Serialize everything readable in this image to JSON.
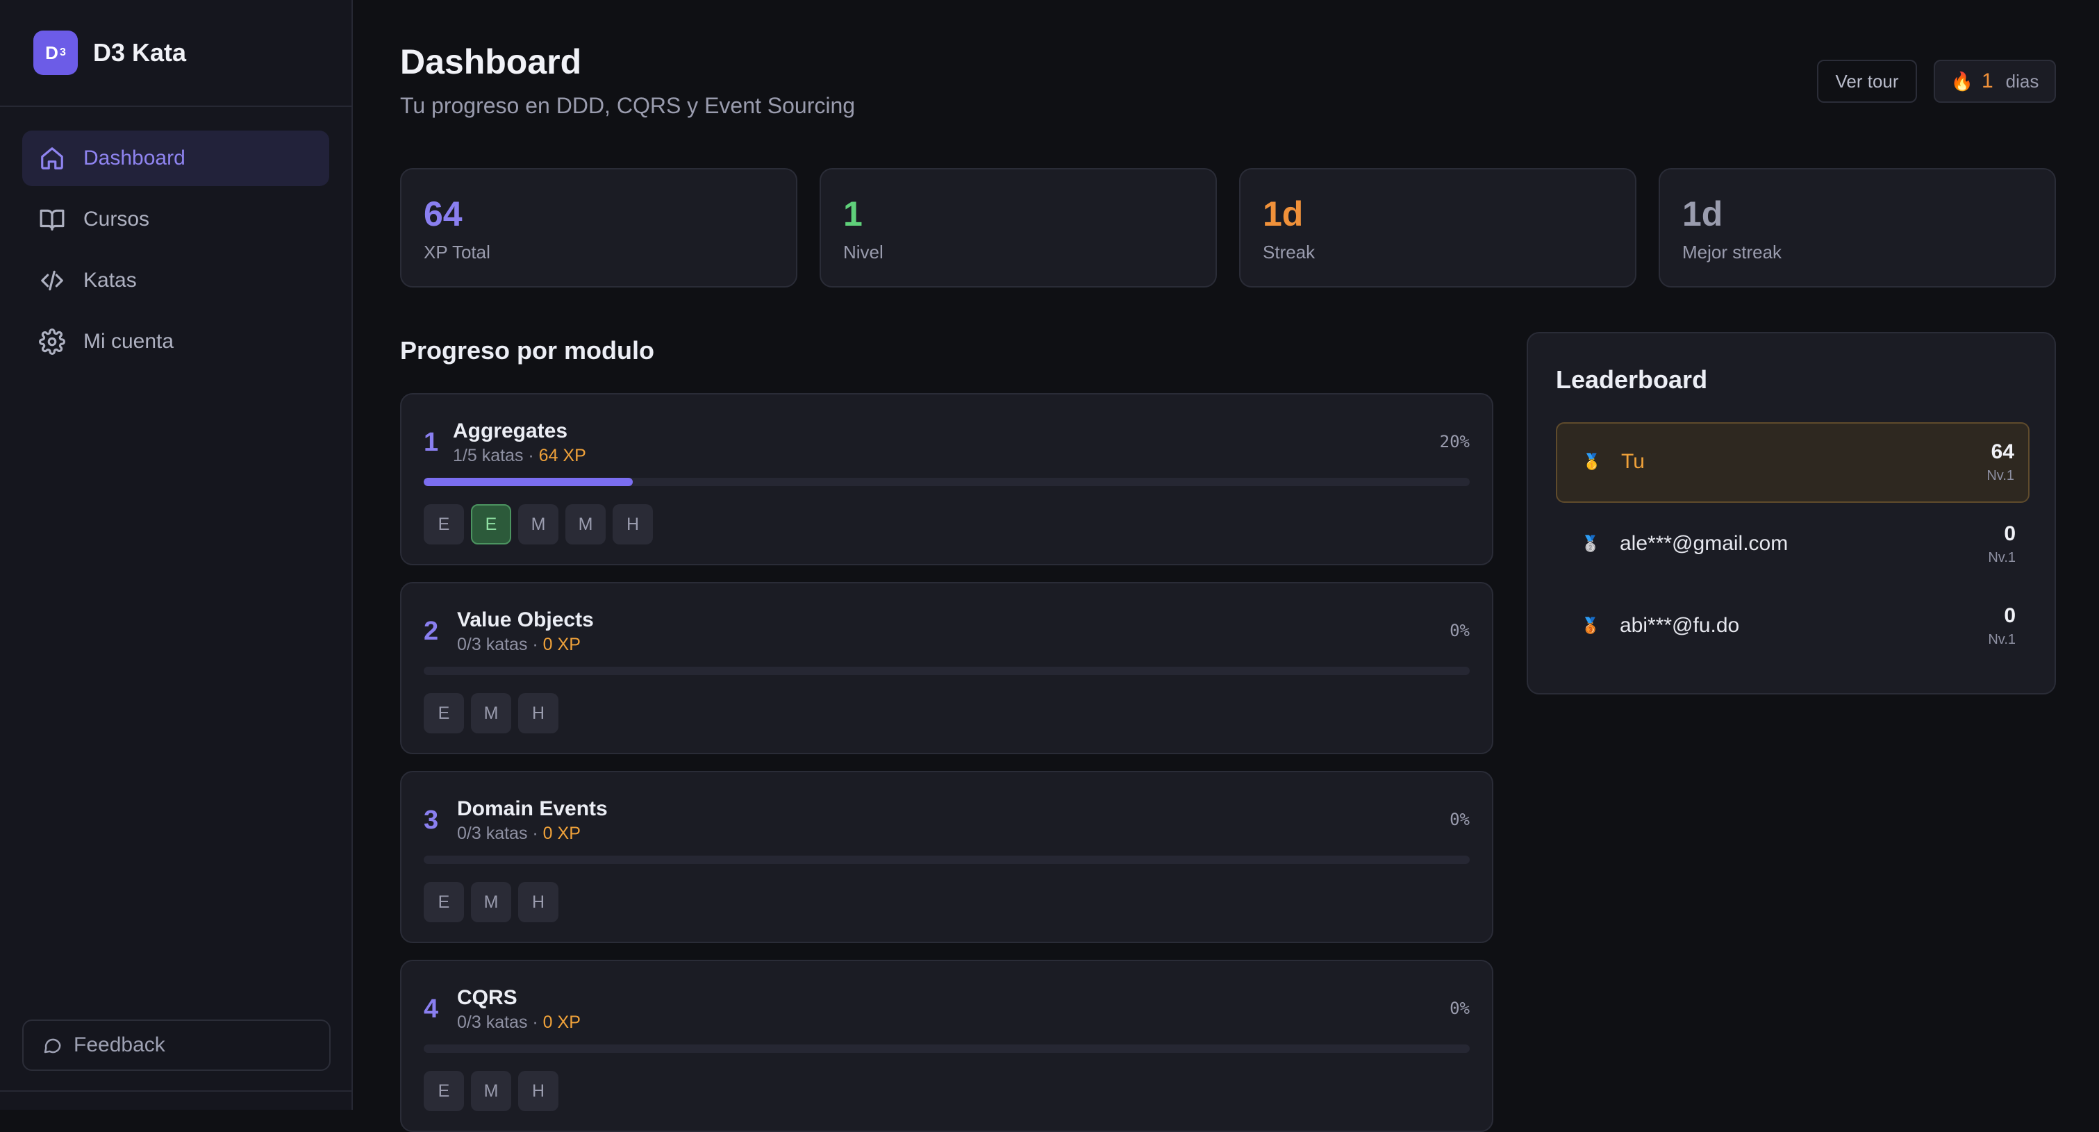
{
  "brand": {
    "logo_text": "D",
    "logo_sup": "3",
    "name": "D3 Kata"
  },
  "nav": {
    "items": [
      {
        "label": "Dashboard",
        "icon": "home-icon",
        "active": true
      },
      {
        "label": "Cursos",
        "icon": "book-icon",
        "active": false
      },
      {
        "label": "Katas",
        "icon": "code-icon",
        "active": false
      },
      {
        "label": "Mi cuenta",
        "icon": "gear-icon",
        "active": false
      }
    ]
  },
  "feedback": {
    "label": "Feedback",
    "icon": "chat-bubble-icon"
  },
  "header": {
    "title": "Dashboard",
    "subtitle": "Tu progreso en DDD, CQRS y Event Sourcing",
    "tour_label": "Ver tour",
    "streak_icon": "🔥",
    "streak_value": "1",
    "streak_unit": "dias"
  },
  "stats": [
    {
      "value": "64",
      "label": "XP Total",
      "color": "#8a7ff0"
    },
    {
      "value": "1",
      "label": "Nivel",
      "color": "#5fd07a"
    },
    {
      "value": "1d",
      "label": "Streak",
      "color": "#f0913a"
    },
    {
      "value": "1d",
      "label": "Mejor streak",
      "color": "#9a9cae"
    }
  ],
  "progress_section": {
    "title": "Progreso por modulo",
    "modules": [
      {
        "number": "1",
        "name": "Aggregates",
        "katas": "1/5 katas",
        "sep": " · ",
        "xp": "64 XP",
        "percent": "20%",
        "progress": 0.2,
        "chips": [
          {
            "label": "E",
            "done": false
          },
          {
            "label": "E",
            "done": true
          },
          {
            "label": "M",
            "done": false
          },
          {
            "label": "M",
            "done": false
          },
          {
            "label": "H",
            "done": false
          }
        ]
      },
      {
        "number": "2",
        "name": "Value Objects",
        "katas": "0/3 katas",
        "sep": " · ",
        "xp": "0 XP",
        "percent": "0%",
        "progress": 0,
        "chips": [
          {
            "label": "E",
            "done": false
          },
          {
            "label": "M",
            "done": false
          },
          {
            "label": "H",
            "done": false
          }
        ]
      },
      {
        "number": "3",
        "name": "Domain Events",
        "katas": "0/3 katas",
        "sep": " · ",
        "xp": "0 XP",
        "percent": "0%",
        "progress": 0,
        "chips": [
          {
            "label": "E",
            "done": false
          },
          {
            "label": "M",
            "done": false
          },
          {
            "label": "H",
            "done": false
          }
        ]
      },
      {
        "number": "4",
        "name": "CQRS",
        "katas": "0/3 katas",
        "sep": " · ",
        "xp": "0 XP",
        "percent": "0%",
        "progress": 0,
        "chips": [
          {
            "label": "E",
            "done": false
          },
          {
            "label": "M",
            "done": false
          },
          {
            "label": "H",
            "done": false
          }
        ]
      }
    ]
  },
  "leaderboard": {
    "title": "Leaderboard",
    "rows": [
      {
        "medal": "🥇",
        "name": "Tu",
        "score": "64",
        "level": "Nv.1",
        "is_me": true
      },
      {
        "medal": "🥈",
        "name": "ale***@gmail.com",
        "score": "0",
        "level": "Nv.1",
        "is_me": false
      },
      {
        "medal": "🥉",
        "name": "abi***@fu.do",
        "score": "0",
        "level": "Nv.1",
        "is_me": false
      }
    ]
  }
}
